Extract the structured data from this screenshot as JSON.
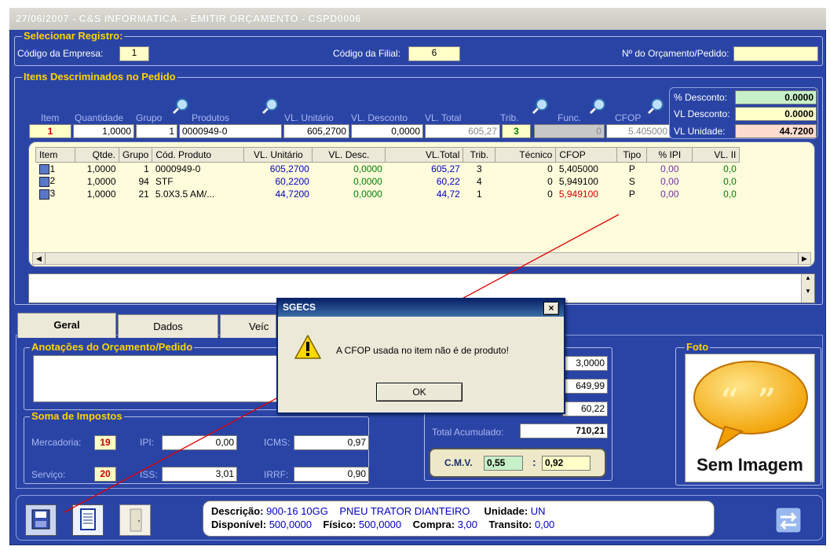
{
  "title": "27/06/2007 - C&S INFORMATICA. - EMITIR ORÇAMENTO - CSPD0006",
  "selecionar": {
    "legend": "Selecionar Registro:",
    "empresa_label": "Código da Empresa:",
    "empresa_value": "1",
    "filial_label": "Código da Filial:",
    "filial_value": "6",
    "orcamento_label": "Nº do Orçamento/Pedido:",
    "orcamento_value": ""
  },
  "itens": {
    "legend": "Itens Descriminados no Pedido",
    "headers": [
      "Item",
      "Quantidade",
      "Grupo",
      "Produtos",
      "VL. Unitário",
      "VL. Desconto",
      "VL. Total",
      "Trib.",
      "Func.",
      "CFOP"
    ],
    "entry": {
      "item": "1",
      "quantidade": "1,0000",
      "grupo": "1",
      "produto": "0000949-0",
      "vl_unitario": "605,2700",
      "vl_desconto": "0,0000",
      "vl_total": "605,27",
      "trib": "3",
      "func": "0",
      "cfop": "5.405000"
    },
    "summary": {
      "desconto_pct_label": "% Desconto:",
      "desconto_pct_value": "0.0000",
      "vl_desconto_label": "VL Desconto:",
      "vl_desconto_value": "0.0000",
      "vl_unidade_label": "VL Unidade:",
      "vl_unidade_value": "44.7200"
    }
  },
  "grid": {
    "columns": [
      "Item",
      "Qtde.",
      "Grupo",
      "Cód. Produto",
      "VL. Unitário",
      "VL. Desc.",
      "VL.Total",
      "Trib.",
      "Técnico",
      "CFOP",
      "Tipo",
      "% IPI",
      "VL. II"
    ],
    "rows": [
      {
        "item": "1",
        "qtde": "1,0000",
        "grupo": "1",
        "cod": "0000949-0",
        "vl_unit": "605,2700",
        "vl_desc": "0,0000",
        "vl_total": "605,27",
        "trib": "3",
        "tecnico": "0",
        "cfop": "5,405000",
        "tipo": "P",
        "ipi": "0,00",
        "vl_ii": "0,0"
      },
      {
        "item": "2",
        "qtde": "1,0000",
        "grupo": "94",
        "cod": "STF",
        "vl_unit": "60,2200",
        "vl_desc": "0,0000",
        "vl_total": "60,22",
        "trib": "4",
        "tecnico": "0",
        "cfop": "5,949100",
        "tipo": "S",
        "ipi": "0,00",
        "vl_ii": "0,0"
      },
      {
        "item": "3",
        "qtde": "1,0000",
        "grupo": "21",
        "cod": "5.0X3.5  AM/...",
        "vl_unit": "44,7200",
        "vl_desc": "0,0000",
        "vl_total": "44,72",
        "trib": "1",
        "tecnico": "0",
        "cfop": "5,949100",
        "tipo": "P",
        "ipi": "0,00",
        "vl_ii": "0,0"
      }
    ]
  },
  "tabs": [
    "Geral",
    "Dados",
    "Veíc"
  ],
  "anotacoes": {
    "legend": "Anotações do Orçamento/Pedido"
  },
  "impostos": {
    "legend": "Soma de Impostos",
    "mercadoria_label": "Mercadoria:",
    "mercadoria_value": "19",
    "servico_label": "Serviço:",
    "servico_value": "20",
    "ipi_label": "IPI:",
    "ipi_value": "0,00",
    "iss_label": "ISS:",
    "iss_value": "3,01",
    "icms_label": "ICMS:",
    "icms_value": "0,97",
    "irrf_label": "IRRF:",
    "irrf_value": "0,90"
  },
  "totais": {
    "v1": "3,0000",
    "v2": "649,99",
    "v3": "60,22",
    "acumulado_label": "Total Acumulado:",
    "acumulado_value": "710,21",
    "cmv_label": "C.M.V.",
    "cmv_v1": "0,55",
    "cmv_v2": "0,92"
  },
  "foto": {
    "legend": "Foto",
    "sem_imagem": "Sem Imagem"
  },
  "dialog": {
    "title": "SGECS",
    "message": "A CFOP usada no item não é de produto!",
    "ok": "OK",
    "close": "×"
  },
  "footer": {
    "descricao_label": "Descrição:",
    "descricao_value": "900-16 10GG",
    "descricao_extra": "PNEU TRATOR DIANTEIRO",
    "unidade_label": "Unidade:",
    "unidade_value": "UN",
    "disponivel_label": "Disponível:",
    "disponivel_value": "500,0000",
    "fisico_label": "Físico:",
    "fisico_value": "500,0000",
    "compra_label": "Compra:",
    "compra_value": "3,00",
    "transito_label": "Transito:",
    "transito_value": "0,00"
  }
}
